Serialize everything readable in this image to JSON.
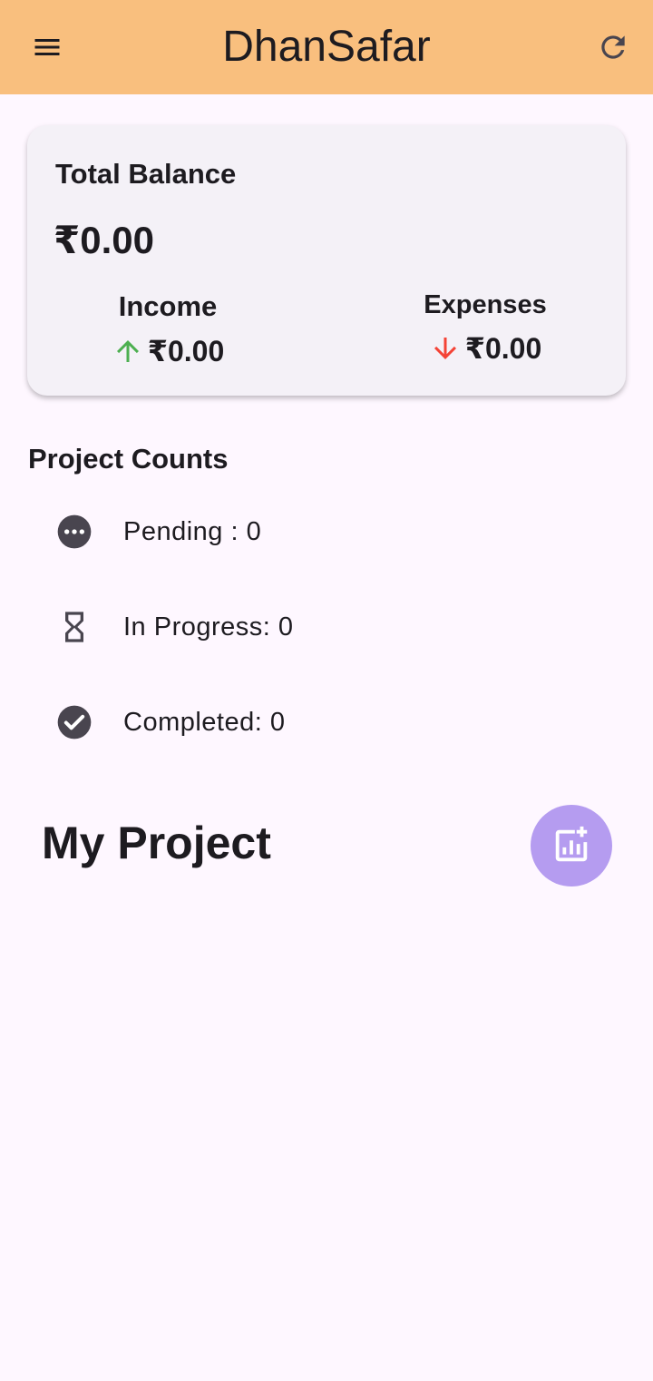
{
  "appbar": {
    "title": "DhanSafar",
    "menu_icon": "menu-icon",
    "refresh_icon": "refresh-icon",
    "background_color": "#F9BF7E"
  },
  "balance_card": {
    "label": "Total Balance",
    "total": "₹0.00",
    "income": {
      "label": "Income",
      "amount": "₹0.00",
      "icon": "arrow-up-icon",
      "color": "#4CAF50"
    },
    "expenses": {
      "label": "Expenses",
      "amount": "₹0.00",
      "icon": "arrow-down-icon",
      "color": "#F44336"
    }
  },
  "project_counts": {
    "title": "Project Counts",
    "items": [
      {
        "icon": "more-horiz-circle-icon",
        "text": "Pending : 0"
      },
      {
        "icon": "hourglass-icon",
        "text": "In Progress: 0"
      },
      {
        "icon": "check-circle-icon",
        "text": "Completed: 0"
      }
    ]
  },
  "my_project": {
    "title": "My Project",
    "add_button_icon": "add-chart-icon",
    "button_color": "#B59CF0"
  }
}
